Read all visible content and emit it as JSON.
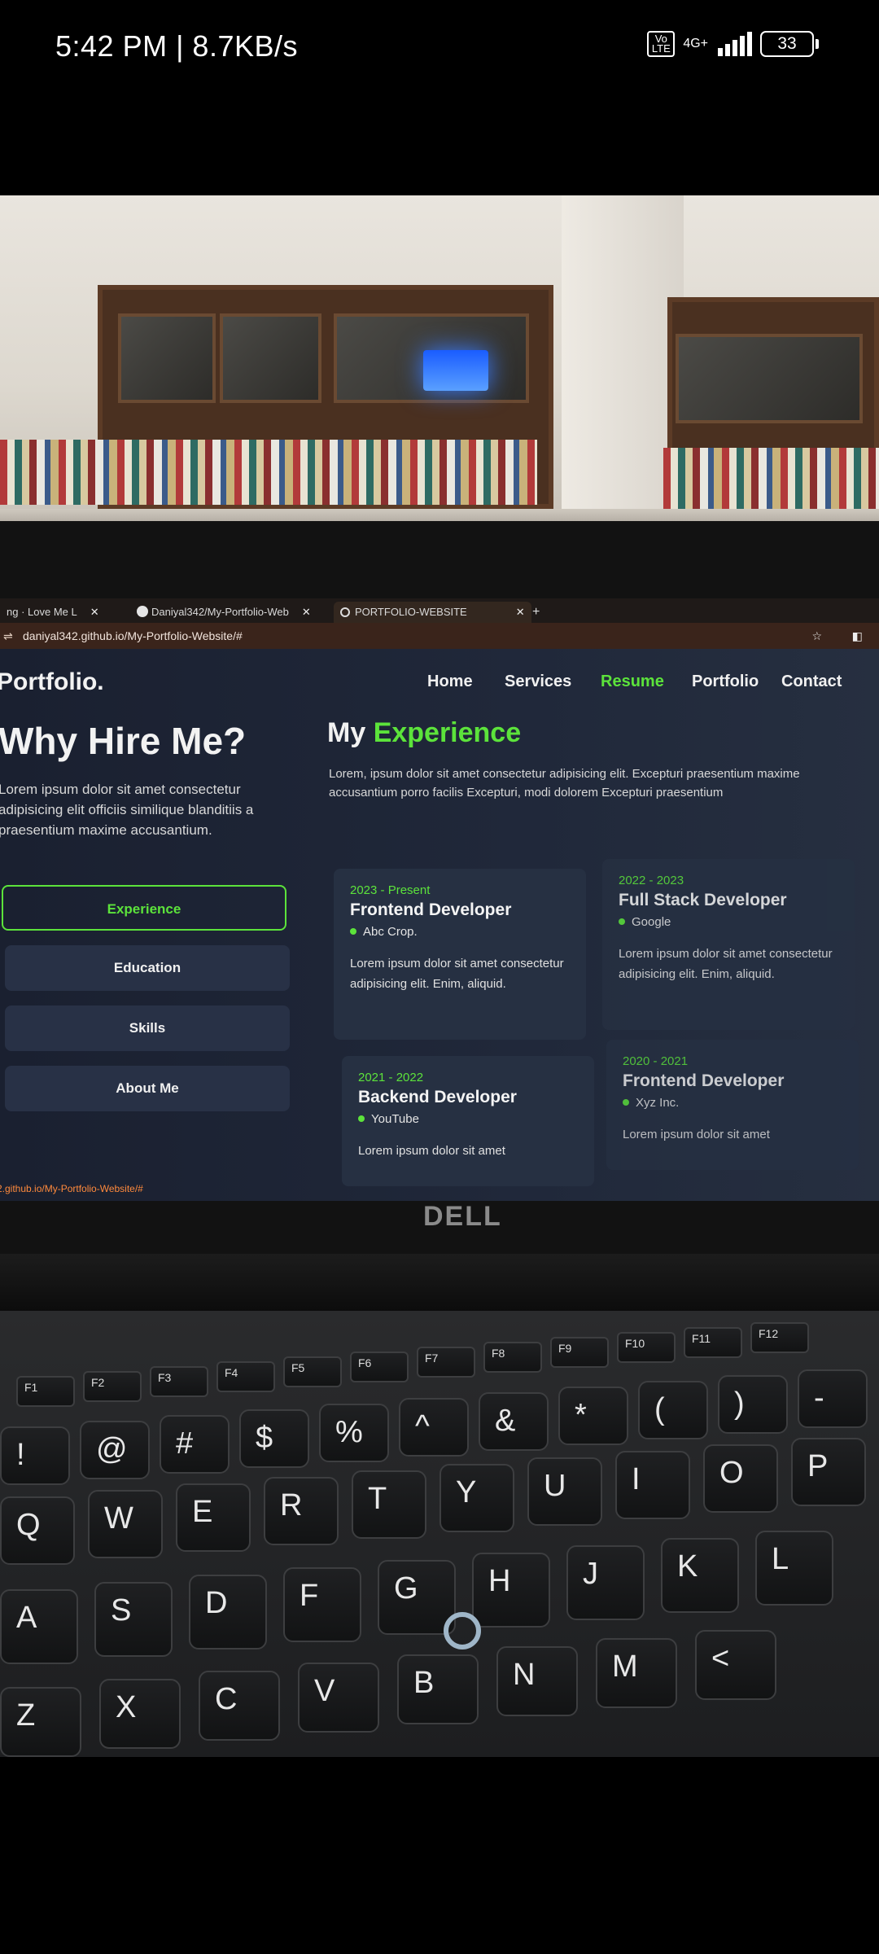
{
  "status_bar": {
    "time": "5:42 PM | 8.7KB/s",
    "volte": "Vo LTE",
    "network": "4G+",
    "battery": "33"
  },
  "browser": {
    "tabs": [
      {
        "label": "ng · Love Me L",
        "close": "✕"
      },
      {
        "label": "Daniyal342/My-Portfolio-Web",
        "close": "✕"
      },
      {
        "label": "PORTFOLIO-WEBSITE",
        "close": "✕"
      }
    ],
    "new_tab": "+",
    "url": "daniyal342.github.io/My-Portfolio-Website/#",
    "status_url": "2.github.io/My-Portfolio-Website/#"
  },
  "site": {
    "logo": "Portfolio.",
    "nav": [
      "Home",
      "Services",
      "Resume",
      "Portfolio",
      "Contact"
    ],
    "nav_active": "Resume",
    "why_title": "Why Hire Me?",
    "why_text": "Lorem ipsum dolor sit amet consectetur adipisicing elit officiis similique blanditiis a praesentium maxime accusantium.",
    "side_buttons": [
      "Experience",
      "Education",
      "Skills",
      "About Me"
    ],
    "experience_title_prefix": "My",
    "experience_title_highlight": "Experience",
    "experience_text": "Lorem, ipsum dolor sit amet consectetur adipisicing elit. Excepturi praesentium maxime accusantium porro facilis Excepturi, modi dolorem Excepturi praesentium",
    "cards": [
      {
        "date": "2023 - Present",
        "role": "Frontend Developer",
        "company": "Abc Crop.",
        "desc": "Lorem ipsum dolor sit amet consectetur adipisicing elit. Enim, aliquid."
      },
      {
        "date": "2022 - 2023",
        "role": "Full Stack Developer",
        "company": "Google",
        "desc": "Lorem ipsum dolor sit amet consectetur adipisicing elit. Enim, aliquid."
      },
      {
        "date": "2021 - 2022",
        "role": "Backend Developer",
        "company": "YouTube",
        "desc": "Lorem ipsum dolor sit amet"
      },
      {
        "date": "2020 - 2021",
        "role": "Frontend Developer",
        "company": "Xyz Inc.",
        "desc": "Lorem ipsum dolor sit amet"
      }
    ]
  },
  "laptop_brand": "DELL",
  "keyboard": {
    "fn_keys": [
      "F1",
      "F2",
      "F3",
      "F4",
      "F5",
      "F6",
      "F7",
      "F8",
      "F9",
      "F10",
      "F11",
      "F12"
    ],
    "number_row": [
      "!",
      "@\n2",
      "#\n3",
      "$\n4",
      "%\n5",
      "^\n6",
      "&\n7",
      "*\n8",
      "(\n9",
      ")\n0",
      "-"
    ],
    "row_q": [
      "Q",
      "W",
      "E",
      "R",
      "T",
      "Y",
      "U",
      "I",
      "O",
      "P"
    ],
    "row_a": [
      "A",
      "S",
      "D",
      "F",
      "G",
      "H",
      "J",
      "K",
      "L"
    ],
    "row_z": [
      "Z",
      "X",
      "C",
      "V",
      "B",
      "N",
      "M",
      "<"
    ]
  }
}
